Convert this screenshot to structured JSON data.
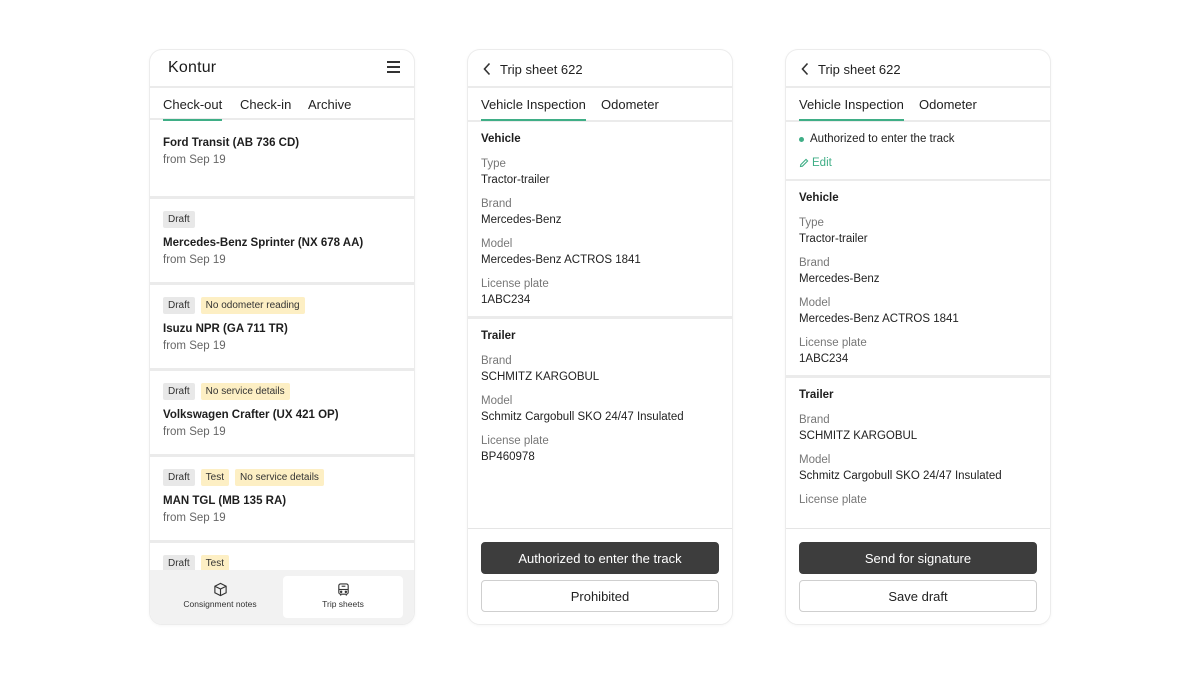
{
  "phone1": {
    "logo": "Kontur",
    "tabs": [
      "Check-out",
      "Check-in",
      "Archive"
    ],
    "cards": [
      {
        "badges": [],
        "title": "Ford Transit (AB 736 CD)",
        "sub": "from Sep 19"
      },
      {
        "badges": [
          {
            "text": "Draft",
            "kind": "draft"
          }
        ],
        "title": "Mercedes-Benz Sprinter (NX 678 AA)",
        "sub": "from Sep 19"
      },
      {
        "badges": [
          {
            "text": "Draft",
            "kind": "draft"
          },
          {
            "text": "No odometer reading",
            "kind": "warn"
          }
        ],
        "title": "Isuzu NPR (GA 711 TR)",
        "sub": "from Sep 19"
      },
      {
        "badges": [
          {
            "text": "Draft",
            "kind": "draft"
          },
          {
            "text": "No service details",
            "kind": "warn"
          }
        ],
        "title": "Volkswagen Crafter (UX 421 OP)",
        "sub": "from Sep 19"
      },
      {
        "badges": [
          {
            "text": "Draft",
            "kind": "draft"
          },
          {
            "text": "Test",
            "kind": "warn"
          },
          {
            "text": "No service details",
            "kind": "warn"
          }
        ],
        "title": "MAN TGL (MB 135 RA)",
        "sub": "from Sep 19"
      },
      {
        "badges": [
          {
            "text": "Draft",
            "kind": "draft"
          },
          {
            "text": "Test",
            "kind": "warn"
          }
        ],
        "title": "",
        "sub": ""
      }
    ],
    "nav": {
      "consignment": "Consignment notes",
      "trips": "Trip sheets"
    }
  },
  "phone2": {
    "title": "Trip sheet 622",
    "tabs": {
      "inspection": "Vehicle Inspection",
      "odometer": "Odometer"
    },
    "vehicle": {
      "section": "Vehicle",
      "type_label": "Type",
      "type": "Tractor-trailer",
      "brand_label": "Brand",
      "brand": "Mercedes-Benz",
      "model_label": "Model",
      "model": "Mercedes-Benz ACTROS 1841",
      "plate_label": "License plate",
      "plate": "1ABC234"
    },
    "trailer": {
      "section": "Trailer",
      "brand_label": "Brand",
      "brand": "SCHMITZ KARGOBUL",
      "model_label": "Model",
      "model": "Schmitz Cargobull SKO 24/47 Insulated",
      "plate_label": "License plate",
      "plate": "BP460978"
    },
    "buttons": {
      "primary": "Authorized to enter the track",
      "secondary": "Prohibited"
    }
  },
  "phone3": {
    "title": "Trip sheet 622",
    "tabs": {
      "inspection": "Vehicle Inspection",
      "odometer": "Odometer"
    },
    "status": "Authorized to enter the track",
    "edit": "Edit",
    "vehicle": {
      "section": "Vehicle",
      "type_label": "Type",
      "type": "Tractor-trailer",
      "brand_label": "Brand",
      "brand": "Mercedes-Benz",
      "model_label": "Model",
      "model": "Mercedes-Benz ACTROS 1841",
      "plate_label": "License plate",
      "plate": "1ABC234"
    },
    "trailer": {
      "section": "Trailer",
      "brand_label": "Brand",
      "brand": "SCHMITZ KARGOBUL",
      "model_label": "Model",
      "model": "Schmitz Cargobull SKO 24/47 Insulated",
      "plate_label": "License plate"
    },
    "buttons": {
      "primary": "Send for signature",
      "secondary": "Save draft"
    }
  },
  "colors": {
    "accent": "#3fae86",
    "warn_badge": "#fdefc4",
    "draft_badge": "#e8e8e8",
    "primary_button": "#3d3d3d"
  }
}
